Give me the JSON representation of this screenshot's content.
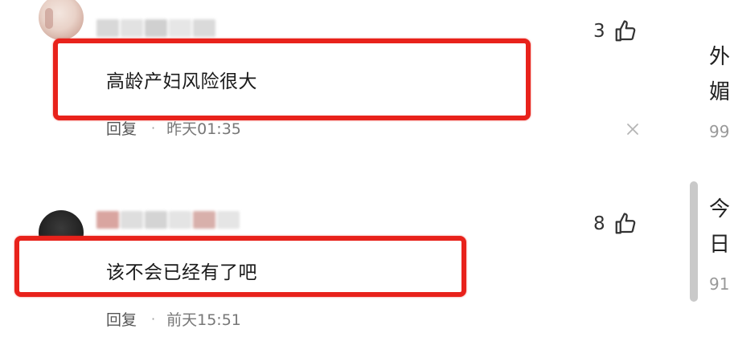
{
  "comments": [
    {
      "text": "高龄产妇风险很大",
      "reply_label": "回复",
      "separator": "·",
      "time": "昨天01:35",
      "likes": "3",
      "icons": [
        "thumbs-up-icon",
        "close-icon"
      ]
    },
    {
      "text": "该不会已经有了吧",
      "reply_label": "回复",
      "separator": "·",
      "time": "前天15:51",
      "likes": "8",
      "icons": [
        "thumbs-up-icon"
      ]
    }
  ],
  "sidebar": {
    "item1_line1": "外",
    "item1_line2": "媚",
    "item1_count": "99",
    "item2_line1": "今",
    "item2_line2": "日",
    "item2_count": "91"
  },
  "colors": {
    "highlight_border": "#e8221b",
    "text_primary": "#1a1a1a",
    "text_secondary": "#777777",
    "scrollbar": "#c9c9c9"
  }
}
